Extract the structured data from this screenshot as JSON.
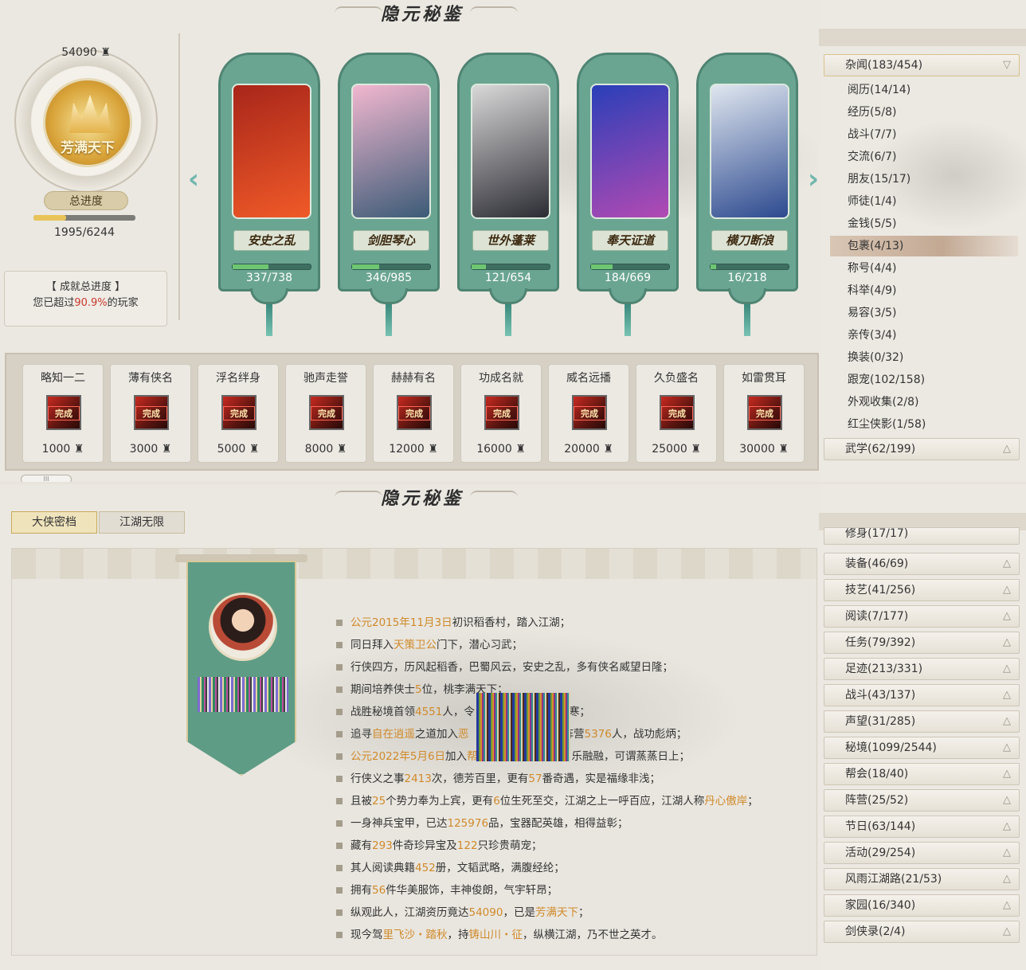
{
  "title": "隐元秘鉴",
  "badge": {
    "points": "54090",
    "name": "芳满天下"
  },
  "total_progress": {
    "label": "总进度",
    "current": 1995,
    "total": 6244,
    "text": "1995/6244"
  },
  "rank": {
    "line1": "【 成就总进度 】",
    "prefix": "您已超过",
    "percent": "90.9%",
    "suffix": "的玩家"
  },
  "cards": [
    {
      "name": "安史之乱",
      "current": 337,
      "total": 738,
      "text": "337/738",
      "colors": [
        "#a8261a",
        "#f05a28"
      ]
    },
    {
      "name": "剑胆琴心",
      "current": 346,
      "total": 985,
      "text": "346/985",
      "colors": [
        "#f1b7cf",
        "#3c5b77"
      ]
    },
    {
      "name": "世外蓬莱",
      "current": 121,
      "total": 654,
      "text": "121/654",
      "colors": [
        "#d8d8d8",
        "#2c2c34"
      ]
    },
    {
      "name": "奉天证道",
      "current": 184,
      "total": 669,
      "text": "184/669",
      "colors": [
        "#2a3fb8",
        "#b24ab3"
      ]
    },
    {
      "name": "横刀断浪",
      "current": 16,
      "total": 218,
      "text": "16/218",
      "colors": [
        "#dfe6ef",
        "#2d4a8f"
      ]
    }
  ],
  "achievements": [
    {
      "name": "略知一二",
      "pts": "1000",
      "done": "完成"
    },
    {
      "name": "薄有侠名",
      "pts": "3000",
      "done": "完成"
    },
    {
      "name": "浮名绊身",
      "pts": "5000",
      "done": "完成"
    },
    {
      "name": "驰声走誉",
      "pts": "8000",
      "done": "完成"
    },
    {
      "name": "赫赫有名",
      "pts": "12000",
      "done": "完成"
    },
    {
      "name": "功成名就",
      "pts": "16000",
      "done": "完成"
    },
    {
      "name": "威名远播",
      "pts": "20000",
      "done": "完成"
    },
    {
      "name": "久负盛名",
      "pts": "25000",
      "done": "完成"
    },
    {
      "name": "如雷贯耳",
      "pts": "30000",
      "done": "完成"
    }
  ],
  "scroll_label": "III",
  "right_top": {
    "open_category": "杂闻(183/454)",
    "subs": [
      "阅历(14/14)",
      "经历(5/8)",
      "战斗(7/7)",
      "交流(6/7)",
      "朋友(15/17)",
      "师徒(1/4)",
      "金钱(5/5)",
      "包裹(4/13)",
      "称号(4/4)",
      "科举(4/9)",
      "易容(3/5)",
      "亲传(3/4)",
      "换装(0/32)",
      "跟宠(102/158)",
      "外观收集(2/8)",
      "红尘侠影(1/58)"
    ],
    "selected": "包裹(4/13)",
    "next_category": "武学(62/199)"
  },
  "right_bottom": {
    "partial": "修身(17/17)",
    "categories": [
      "装备(46/69)",
      "技艺(41/256)",
      "阅读(7/177)",
      "任务(79/392)",
      "足迹(213/331)",
      "战斗(43/137)",
      "声望(31/285)",
      "秘境(1099/2544)",
      "帮会(18/40)",
      "阵营(25/52)",
      "节日(63/144)",
      "活动(29/254)",
      "风雨江湖路(21/53)",
      "家园(16/340)",
      "剑侠录(2/4)"
    ]
  },
  "tabs": [
    "大侠密档",
    "江湖无限"
  ],
  "story": [
    [
      [
        "公元2015年11月3日",
        "o"
      ],
      [
        "初识稻香村，踏入江湖；",
        ""
      ]
    ],
    [
      [
        "同日拜入",
        ""
      ],
      [
        "天策卫公",
        "o"
      ],
      [
        "门下，潜心习武；",
        ""
      ]
    ],
    [
      [
        "行侠四方，历风起稻香，巴蜀风云，安史之乱，多有侠名威望日隆；",
        ""
      ]
    ],
    [
      [
        "期间培养侠士",
        ""
      ],
      [
        "5",
        "o"
      ],
      [
        "位，桃李满天下；",
        ""
      ]
    ],
    [
      [
        "战胜秘境首领",
        ""
      ],
      [
        "4551",
        "o"
      ],
      [
        "人，令",
        ""
      ],
      [
        "",
        "gap"
      ],
      [
        "寒；",
        ""
      ]
    ],
    [
      [
        "追寻",
        ""
      ],
      [
        "自在逍遥",
        "o"
      ],
      [
        "之道加入",
        ""
      ],
      [
        "恶",
        "o"
      ],
      [
        "",
        "gap"
      ],
      [
        "阵营",
        ""
      ],
      [
        "5376",
        "o"
      ],
      [
        "人，战功彪炳；",
        ""
      ]
    ],
    [
      [
        "公元2022年5月6日",
        "o"
      ],
      [
        "加入",
        ""
      ],
      [
        "帮",
        "o"
      ],
      [
        "",
        "gap"
      ],
      [
        "乐融融，可谓蒸蒸日上；",
        ""
      ]
    ],
    [
      [
        "行侠义之事",
        ""
      ],
      [
        "2413",
        "o"
      ],
      [
        "次，德芳百里，更有",
        ""
      ],
      [
        "57",
        "o"
      ],
      [
        "番奇遇，实是福缘非浅；",
        ""
      ]
    ],
    [
      [
        "且被",
        ""
      ],
      [
        "25",
        "o"
      ],
      [
        "个势力奉为上宾，更有",
        ""
      ],
      [
        "6",
        "o"
      ],
      [
        "位生死至交，江湖之上一呼百应，江湖人称",
        ""
      ],
      [
        "丹心傲岸",
        "o"
      ],
      [
        "；",
        ""
      ]
    ],
    [
      [
        "一身神兵宝甲，已达",
        ""
      ],
      [
        "125976",
        "o"
      ],
      [
        "品，宝器配英雄，相得益彰；",
        ""
      ]
    ],
    [
      [
        "藏有",
        ""
      ],
      [
        "293",
        "o"
      ],
      [
        "件奇珍异宝及",
        ""
      ],
      [
        "122",
        "o"
      ],
      [
        "只珍贵萌宠；",
        ""
      ]
    ],
    [
      [
        "其人阅读典籍",
        ""
      ],
      [
        "452",
        "o"
      ],
      [
        "册，文韬武略，满腹经纶；",
        ""
      ]
    ],
    [
      [
        "拥有",
        ""
      ],
      [
        "56",
        "o"
      ],
      [
        "件华美服饰，丰神俊朗，气宇轩昂；",
        ""
      ]
    ],
    [
      [
        "纵观此人，江湖资历竟达",
        ""
      ],
      [
        "54090",
        "o"
      ],
      [
        "，已是",
        ""
      ],
      [
        "芳满天下",
        "o"
      ],
      [
        "；",
        ""
      ]
    ],
    [
      [
        "现今驾",
        ""
      ],
      [
        "里飞沙・踏秋",
        "o"
      ],
      [
        "，持",
        ""
      ],
      [
        "铸山川・征",
        "o"
      ],
      [
        "，纵横江湖，乃不世之英才。",
        ""
      ]
    ]
  ],
  "colors": {
    "highlight": "#d08a2b",
    "jade": "#6aa592",
    "percent": "#c8392d"
  }
}
